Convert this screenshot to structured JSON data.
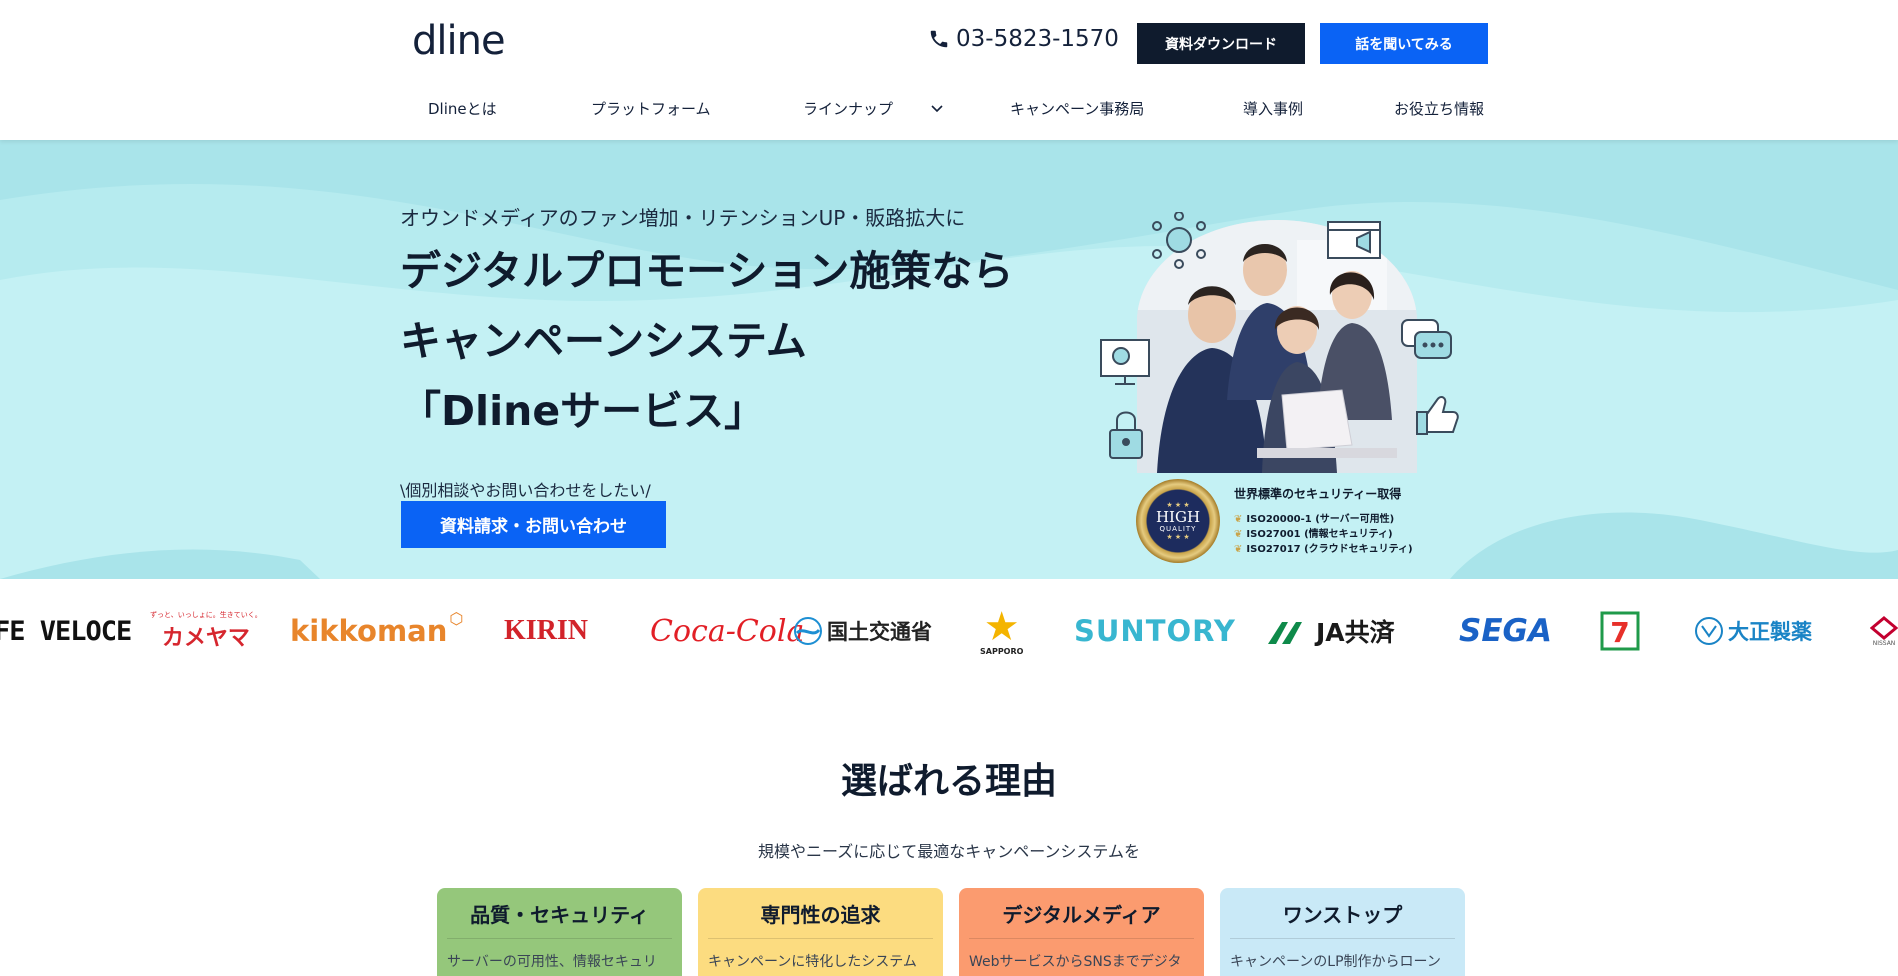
{
  "header": {
    "logo": "dline",
    "phone": "03-5823-1570",
    "download_button": "資料ダウンロード",
    "talk_button": "話を聞いてみる"
  },
  "nav": {
    "items": [
      "Dlineとは",
      "プラットフォーム",
      "ラインナップ",
      "キャンペーン事務局",
      "導入事例",
      "お役立ち情報"
    ]
  },
  "hero": {
    "subtitle": "オウンドメディアのファン増加・リテンションUP・販路拡大に",
    "title_lines": [
      "デジタルプロモーション施策なら",
      "キャンペーンシステム",
      "「Dlineサービス」"
    ],
    "cta_note": "\\個別相談やお問い合わせをしたい/",
    "cta_button": "資料請求・お問い合わせ",
    "security": {
      "badge_main": "HIGH",
      "badge_sub": "QUALITY",
      "heading": "世界標準のセキュリティー取得",
      "items": [
        "ISO20000-1 (サーバー可用性)",
        "ISO27001 (情報セキュリティ)",
        "ISO27017 (クラウドセキュリティ)"
      ]
    }
  },
  "logos": {
    "items": [
      "FE VELOCE",
      "ずっと、いっしょに。生きていく。",
      "カメヤマ",
      "kikkoman",
      "KIRIN",
      "Coca-Cola",
      "国土交通省",
      "SAPPORO",
      "SUNTORY",
      "JA共済",
      "SEGA",
      "大正製薬",
      "NISSAN"
    ]
  },
  "reasons": {
    "title": "選ばれる理由",
    "subtitle": "規模やニーズに応じて最適なキャンペーンシステムを",
    "cards": [
      {
        "title": "品質・セキュリティ",
        "text": "サーバーの可用性、情報セキュリ",
        "color": "#95c77b"
      },
      {
        "title": "専門性の追求",
        "text": "キャンペーンに特化したシステム",
        "color": "#fcdc80"
      },
      {
        "title": "デジタルメディア",
        "text": "WebサービスからSNSまでデジタ",
        "color": "#fb9b6f"
      },
      {
        "title": "ワンストップ",
        "text": "キャンペーンのLP制作からローン",
        "color": "#c9e9f7"
      }
    ]
  },
  "colors": {
    "navy": "#0f1b2d",
    "blue": "#0a63f5",
    "hero_bg": "#b6ebef"
  }
}
